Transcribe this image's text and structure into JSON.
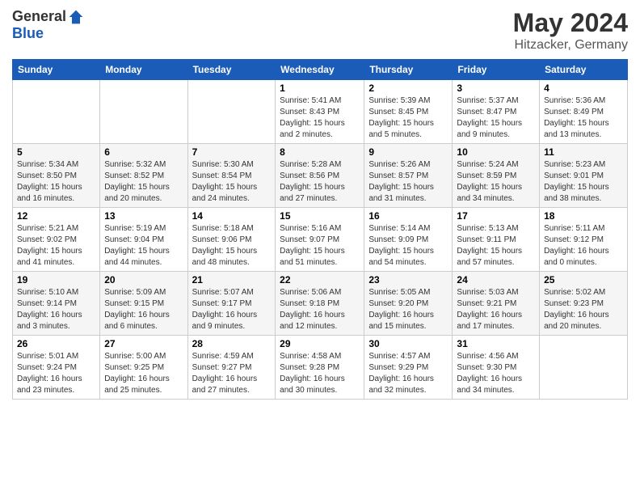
{
  "header": {
    "logo_general": "General",
    "logo_blue": "Blue",
    "month_title": "May 2024",
    "location": "Hitzacker, Germany"
  },
  "weekdays": [
    "Sunday",
    "Monday",
    "Tuesday",
    "Wednesday",
    "Thursday",
    "Friday",
    "Saturday"
  ],
  "weeks": [
    [
      {
        "day": "",
        "info": ""
      },
      {
        "day": "",
        "info": ""
      },
      {
        "day": "",
        "info": ""
      },
      {
        "day": "1",
        "info": "Sunrise: 5:41 AM\nSunset: 8:43 PM\nDaylight: 15 hours\nand 2 minutes."
      },
      {
        "day": "2",
        "info": "Sunrise: 5:39 AM\nSunset: 8:45 PM\nDaylight: 15 hours\nand 5 minutes."
      },
      {
        "day": "3",
        "info": "Sunrise: 5:37 AM\nSunset: 8:47 PM\nDaylight: 15 hours\nand 9 minutes."
      },
      {
        "day": "4",
        "info": "Sunrise: 5:36 AM\nSunset: 8:49 PM\nDaylight: 15 hours\nand 13 minutes."
      }
    ],
    [
      {
        "day": "5",
        "info": "Sunrise: 5:34 AM\nSunset: 8:50 PM\nDaylight: 15 hours\nand 16 minutes."
      },
      {
        "day": "6",
        "info": "Sunrise: 5:32 AM\nSunset: 8:52 PM\nDaylight: 15 hours\nand 20 minutes."
      },
      {
        "day": "7",
        "info": "Sunrise: 5:30 AM\nSunset: 8:54 PM\nDaylight: 15 hours\nand 24 minutes."
      },
      {
        "day": "8",
        "info": "Sunrise: 5:28 AM\nSunset: 8:56 PM\nDaylight: 15 hours\nand 27 minutes."
      },
      {
        "day": "9",
        "info": "Sunrise: 5:26 AM\nSunset: 8:57 PM\nDaylight: 15 hours\nand 31 minutes."
      },
      {
        "day": "10",
        "info": "Sunrise: 5:24 AM\nSunset: 8:59 PM\nDaylight: 15 hours\nand 34 minutes."
      },
      {
        "day": "11",
        "info": "Sunrise: 5:23 AM\nSunset: 9:01 PM\nDaylight: 15 hours\nand 38 minutes."
      }
    ],
    [
      {
        "day": "12",
        "info": "Sunrise: 5:21 AM\nSunset: 9:02 PM\nDaylight: 15 hours\nand 41 minutes."
      },
      {
        "day": "13",
        "info": "Sunrise: 5:19 AM\nSunset: 9:04 PM\nDaylight: 15 hours\nand 44 minutes."
      },
      {
        "day": "14",
        "info": "Sunrise: 5:18 AM\nSunset: 9:06 PM\nDaylight: 15 hours\nand 48 minutes."
      },
      {
        "day": "15",
        "info": "Sunrise: 5:16 AM\nSunset: 9:07 PM\nDaylight: 15 hours\nand 51 minutes."
      },
      {
        "day": "16",
        "info": "Sunrise: 5:14 AM\nSunset: 9:09 PM\nDaylight: 15 hours\nand 54 minutes."
      },
      {
        "day": "17",
        "info": "Sunrise: 5:13 AM\nSunset: 9:11 PM\nDaylight: 15 hours\nand 57 minutes."
      },
      {
        "day": "18",
        "info": "Sunrise: 5:11 AM\nSunset: 9:12 PM\nDaylight: 16 hours\nand 0 minutes."
      }
    ],
    [
      {
        "day": "19",
        "info": "Sunrise: 5:10 AM\nSunset: 9:14 PM\nDaylight: 16 hours\nand 3 minutes."
      },
      {
        "day": "20",
        "info": "Sunrise: 5:09 AM\nSunset: 9:15 PM\nDaylight: 16 hours\nand 6 minutes."
      },
      {
        "day": "21",
        "info": "Sunrise: 5:07 AM\nSunset: 9:17 PM\nDaylight: 16 hours\nand 9 minutes."
      },
      {
        "day": "22",
        "info": "Sunrise: 5:06 AM\nSunset: 9:18 PM\nDaylight: 16 hours\nand 12 minutes."
      },
      {
        "day": "23",
        "info": "Sunrise: 5:05 AM\nSunset: 9:20 PM\nDaylight: 16 hours\nand 15 minutes."
      },
      {
        "day": "24",
        "info": "Sunrise: 5:03 AM\nSunset: 9:21 PM\nDaylight: 16 hours\nand 17 minutes."
      },
      {
        "day": "25",
        "info": "Sunrise: 5:02 AM\nSunset: 9:23 PM\nDaylight: 16 hours\nand 20 minutes."
      }
    ],
    [
      {
        "day": "26",
        "info": "Sunrise: 5:01 AM\nSunset: 9:24 PM\nDaylight: 16 hours\nand 23 minutes."
      },
      {
        "day": "27",
        "info": "Sunrise: 5:00 AM\nSunset: 9:25 PM\nDaylight: 16 hours\nand 25 minutes."
      },
      {
        "day": "28",
        "info": "Sunrise: 4:59 AM\nSunset: 9:27 PM\nDaylight: 16 hours\nand 27 minutes."
      },
      {
        "day": "29",
        "info": "Sunrise: 4:58 AM\nSunset: 9:28 PM\nDaylight: 16 hours\nand 30 minutes."
      },
      {
        "day": "30",
        "info": "Sunrise: 4:57 AM\nSunset: 9:29 PM\nDaylight: 16 hours\nand 32 minutes."
      },
      {
        "day": "31",
        "info": "Sunrise: 4:56 AM\nSunset: 9:30 PM\nDaylight: 16 hours\nand 34 minutes."
      },
      {
        "day": "",
        "info": ""
      }
    ]
  ]
}
